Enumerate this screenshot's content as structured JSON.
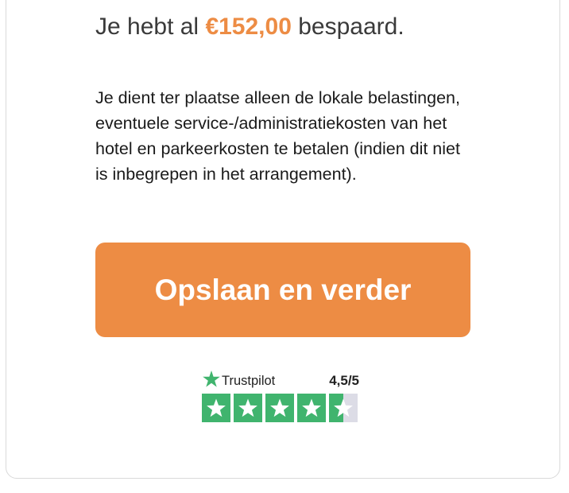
{
  "savings": {
    "prefix": "Je hebt al",
    "amount": "€152,00",
    "suffix": "bespaard."
  },
  "info_text": "Je dient ter plaatse alleen de lokale belastingen, eventuele service-/administratiekosten van het hotel en parkeerkosten te betalen (indien dit niet is inbegrepen in het arrangement).",
  "cta": {
    "label": "Opslaan en verder"
  },
  "trustpilot": {
    "brand": "Trustpilot",
    "score": "4,5/5",
    "rating_value": 4.5,
    "rating_max": 5,
    "logo_icon": "star-icon",
    "colors": {
      "star_fill": "#40b46e",
      "star_empty": "#dcdce6"
    }
  },
  "colors": {
    "accent": "#ed8c44"
  }
}
